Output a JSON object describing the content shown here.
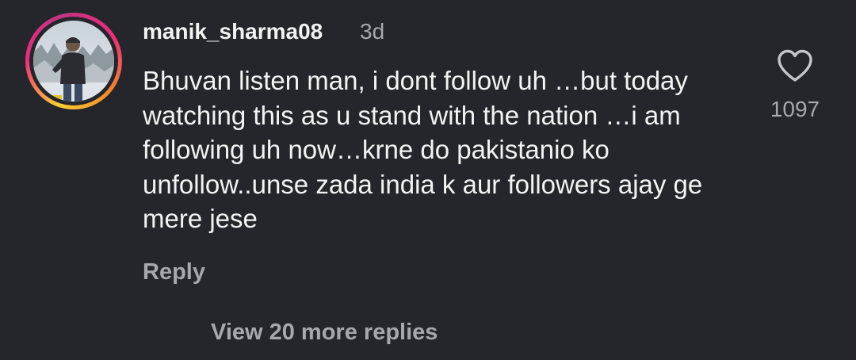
{
  "comment": {
    "username": "manik_sharma08",
    "timestamp": "3d",
    "text": "Bhuvan listen man, i dont follow uh …but today watching this as u stand with the nation …i am following uh now…krne do pakistanio ko unfollow..unse zada india k aur followers ajay ge mere jese",
    "reply_label": "Reply",
    "like_count": "1097",
    "like_icon": "heart-outline-icon",
    "view_replies_label": "View 20 more replies"
  },
  "colors": {
    "background": "#24262b",
    "primary_text": "#f3f3f3",
    "secondary_text": "#a5a8ad",
    "story_ring_start": "#f9ce34",
    "story_ring_mid": "#ee2a7b"
  }
}
